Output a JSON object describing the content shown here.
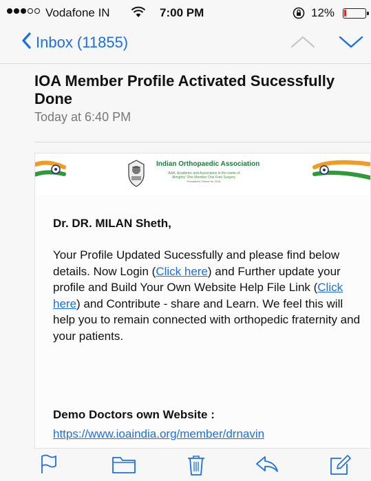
{
  "status_bar": {
    "carrier": "Vodafone IN",
    "time": "7:00 PM",
    "battery_percent": "12%",
    "battery_level": 0.12,
    "signal_bars_filled": 3,
    "signal_bars_total": 5,
    "icons": [
      "wifi-icon",
      "orientation-lock-icon",
      "battery-icon"
    ]
  },
  "nav": {
    "back_label": "Inbox (11855)",
    "icons": [
      "chevron-left-icon",
      "chevron-up-icon",
      "chevron-down-icon"
    ],
    "accent_color": "#1a6fe8"
  },
  "message": {
    "subject": "IOA Member Profile Activated Sucessfully Done",
    "date": "Today at 6:40 PM"
  },
  "banner": {
    "org_name": "Indian Orthopaedic Association",
    "tagline": "'AAA, Academic and Association in the name of Almighty' One Member One Free Surgery",
    "tagline2": "President's Theme for 2016"
  },
  "body": {
    "greeting": "Dr. DR. MILAN Sheth,",
    "para_1": "Your Profile Updated Sucessfully and please find below details. Now Login (",
    "link_1": "Click here",
    "para_2": ") and Further update your profile and Build Your Own Website Help File Link (",
    "link_2": "Click here",
    "para_3": ") and Contribute - share and Learn. We feel this will help you to remain connected with orthopedic fraternity and your patients.",
    "demo_heading": "Demo Doctors own Website :",
    "demo_link": "https://www.ioaindia.org/member/drnavin"
  },
  "toolbar": {
    "icons": [
      "flag-icon",
      "folder-icon",
      "trash-icon",
      "reply-icon",
      "compose-icon"
    ]
  }
}
